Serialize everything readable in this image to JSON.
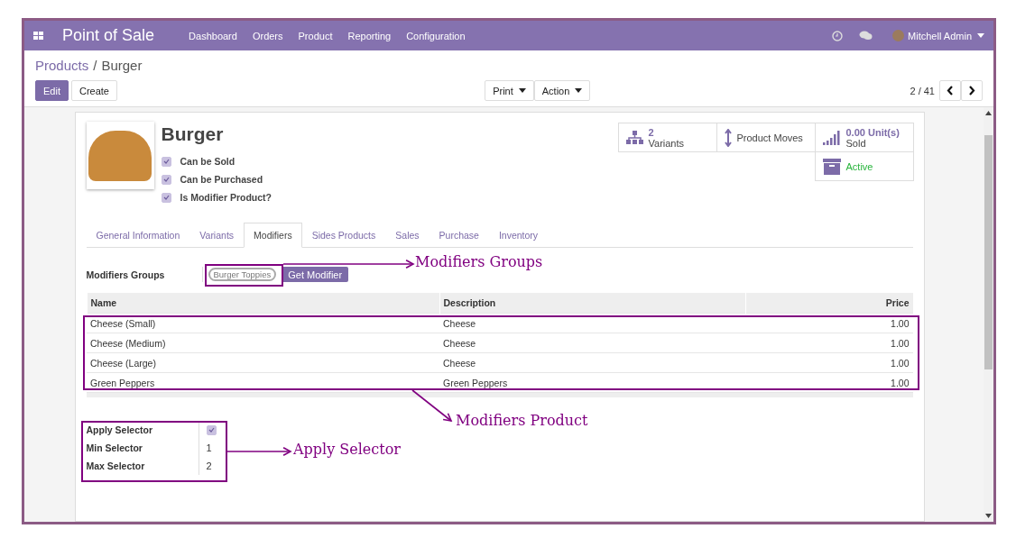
{
  "app": {
    "title": "Point of Sale",
    "menu": [
      "Dashboard",
      "Orders",
      "Product",
      "Reporting",
      "Configuration"
    ],
    "user": "Mitchell Admin"
  },
  "breadcrumb": {
    "parent": "Products",
    "separator": "/",
    "current": "Burger"
  },
  "buttons": {
    "edit": "Edit",
    "create": "Create",
    "print": "Print",
    "action": "Action"
  },
  "pager": "2 / 41",
  "product": {
    "name": "Burger",
    "flags": [
      {
        "label": "Can be Sold",
        "checked": true
      },
      {
        "label": "Can be Purchased",
        "checked": true
      },
      {
        "label": "Is Modifier Product?",
        "checked": true
      }
    ]
  },
  "stat_buttons": [
    {
      "kind": "variants",
      "value": "2",
      "label": "Variants"
    },
    {
      "kind": "moves",
      "label": "Product Moves"
    },
    {
      "kind": "sold",
      "value": "0.00 Unit(s)",
      "label": "Sold"
    },
    {
      "kind": "archive",
      "label": "Active",
      "active": true
    }
  ],
  "tabs": [
    {
      "label": "General Information",
      "selected": false
    },
    {
      "label": "Variants",
      "selected": false
    },
    {
      "label": "Modifiers",
      "selected": true
    },
    {
      "label": "Sides Products",
      "selected": false
    },
    {
      "label": "Sales",
      "selected": false
    },
    {
      "label": "Purchase",
      "selected": false
    },
    {
      "label": "Inventory",
      "selected": false
    }
  ],
  "modifiers": {
    "label": "Modifiers Groups",
    "tags": [
      "Burger Toppies"
    ],
    "button": "Get Modifier",
    "columns": [
      "Name",
      "Description",
      "Price"
    ],
    "rows": [
      [
        "Cheese (Small)",
        "Cheese",
        "1.00"
      ],
      [
        "Cheese (Medium)",
        "Cheese",
        "1.00"
      ],
      [
        "Cheese (Large)",
        "Cheese",
        "1.00"
      ],
      [
        "Green Peppers",
        "Green Peppers",
        "1.00"
      ]
    ]
  },
  "selector": [
    {
      "kind": "checkbox",
      "label": "Apply Selector",
      "checked": true
    },
    {
      "kind": "number",
      "label": "Min Selector",
      "value": "1"
    },
    {
      "kind": "number",
      "label": "Max Selector",
      "value": "2"
    }
  ],
  "annotations": [
    {
      "text": "Modifiers Groups"
    },
    {
      "text": "Modifiers Product"
    },
    {
      "text": "Apply Selector"
    }
  ]
}
